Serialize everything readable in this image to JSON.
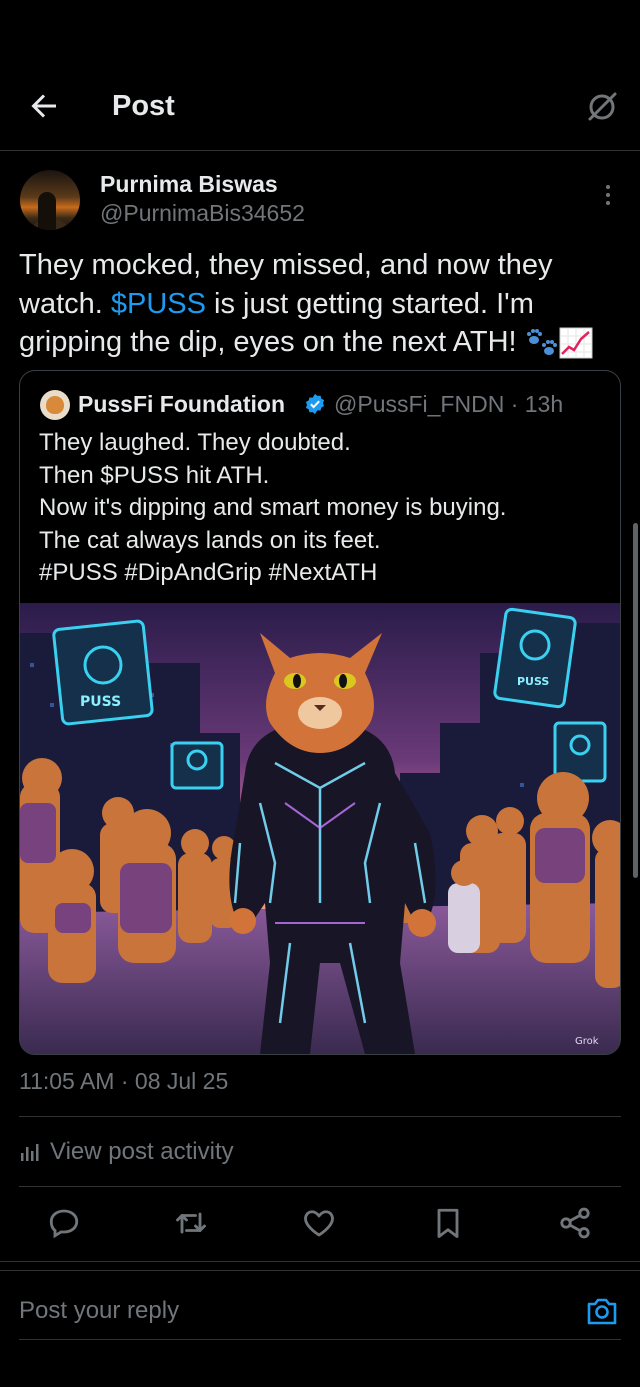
{
  "header": {
    "title": "Post",
    "back_icon": "arrow-left-icon",
    "grok_icon": "grok-icon"
  },
  "author": {
    "name": "Purnima Biswas",
    "handle": "@PurnimaBis34652"
  },
  "post": {
    "text_before": "They mocked, they missed, and now they watch. ",
    "cashtag": "$PUSS",
    "text_after": " is just getting started. I'm gripping the dip, eyes on the next ATH! ",
    "emojis": [
      "paw-prints-icon",
      "chart-increasing-icon"
    ]
  },
  "quote": {
    "name": "PussFi Foundation",
    "handle": "@PussFi_FNDN · 13h",
    "lines": [
      "They laughed. They doubted.",
      "Then $PUSS hit ATH.",
      "Now it's dipping and smart money is buying.",
      "The cat always lands on its feet.",
      "#PUSS #DipAndGrip #NextATH"
    ],
    "image_watermark": "Grok",
    "sign_left": "PUSS",
    "sign_right": "PUSS"
  },
  "meta": {
    "timestamp": "11:05 AM · 08 Jul 25"
  },
  "activity": {
    "label": "View post activity"
  },
  "actions": [
    "reply-icon",
    "repost-icon",
    "like-icon",
    "bookmark-icon",
    "share-icon"
  ],
  "reply": {
    "placeholder": "Post your reply"
  },
  "colors": {
    "accent": "#1d9bf0",
    "background": "#000000",
    "muted": "#71767b",
    "text": "#e7e9ea"
  }
}
